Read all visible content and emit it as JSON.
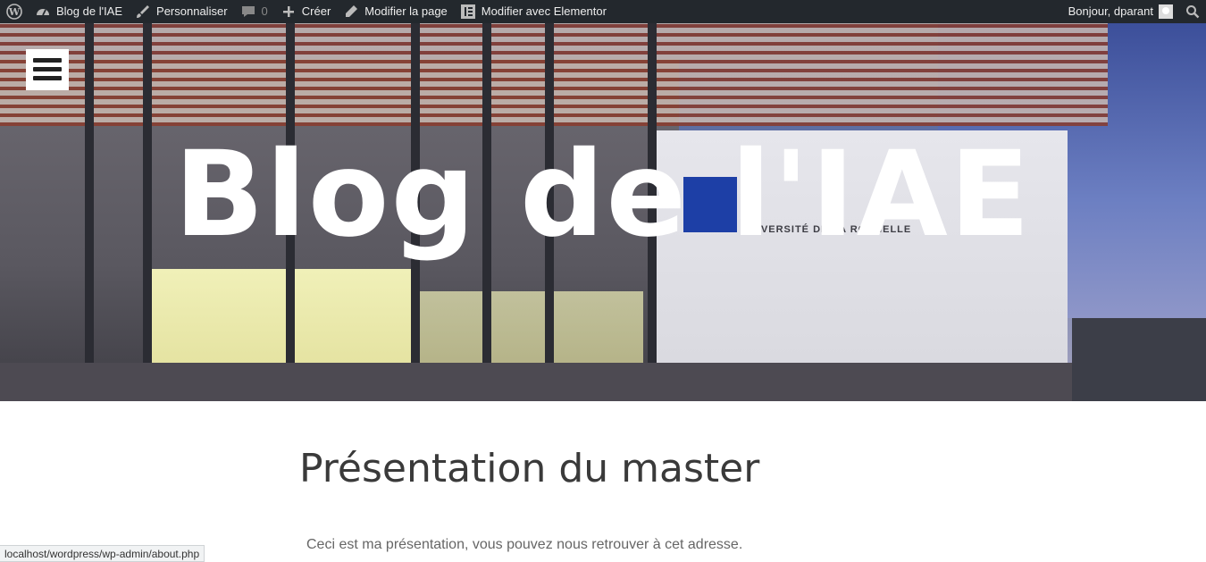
{
  "adminbar": {
    "wp_logo_icon": "wordpress-icon",
    "site_name": "Blog de l'IAE",
    "customize": "Personnaliser",
    "comments_count": "0",
    "create": "Créer",
    "edit_page": "Modifier la page",
    "edit_elementor": "Modifier avec Elementor",
    "greeting": "Bonjour, dparant",
    "search_icon": "search-icon"
  },
  "hero": {
    "site_title": "Blog de l'IAE",
    "menu_icon": "hamburger-icon",
    "sign_text": "UNIVERSITÉ DE LA ROCHELLE"
  },
  "content": {
    "page_title": "Présentation du master",
    "intro_text": "Ceci est ma présentation, vous pouvez nous retrouver à cet adresse."
  },
  "status_url": "localhost/wordpress/wp-admin/about.php"
}
